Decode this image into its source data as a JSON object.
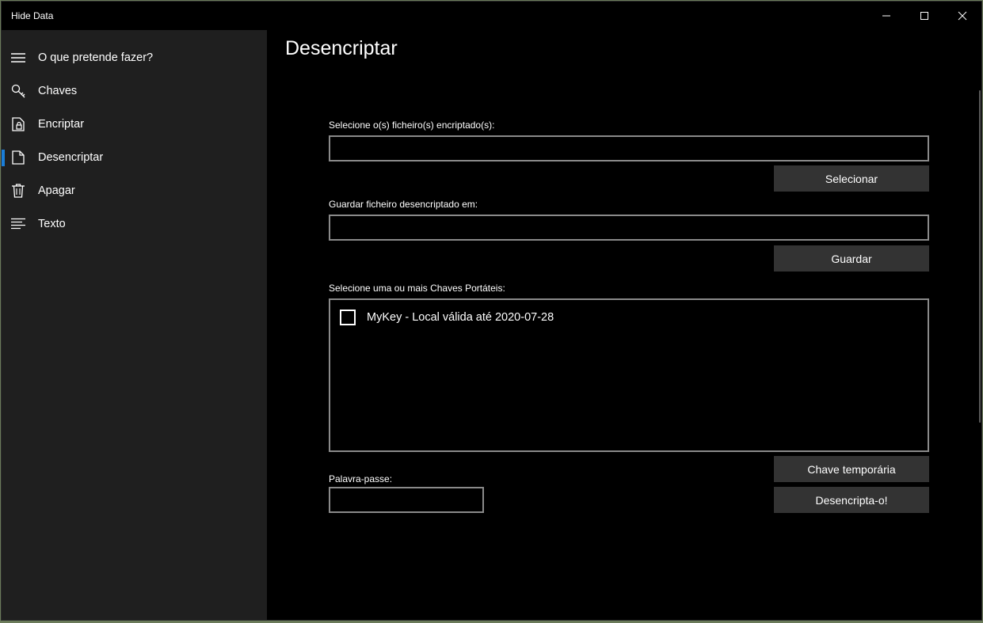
{
  "window": {
    "title": "Hide Data"
  },
  "sidebar": {
    "items": [
      {
        "label": "O que pretende fazer?",
        "icon": "hamburger-icon"
      },
      {
        "label": "Chaves",
        "icon": "key-icon"
      },
      {
        "label": "Encriptar",
        "icon": "lock-document-icon"
      },
      {
        "label": "Desencriptar",
        "icon": "document-icon",
        "selected": true
      },
      {
        "label": "Apagar",
        "icon": "trash-icon"
      },
      {
        "label": "Texto",
        "icon": "text-lines-icon"
      }
    ]
  },
  "main": {
    "title": "Desencriptar",
    "select_files_label": "Selecione o(s) ficheiro(s) encriptado(s):",
    "select_files_value": "",
    "select_button": "Selecionar",
    "save_to_label": "Guardar ficheiro desencriptado em:",
    "save_to_value": "",
    "save_button": "Guardar",
    "keys_label": "Selecione uma ou mais Chaves Portáteis:",
    "keys": [
      {
        "label": "MyKey - Local válida até 2020-07-28",
        "checked": false
      }
    ],
    "password_label": "Palavra-passe:",
    "password_value": "",
    "temp_key_button": "Chave temporária",
    "decrypt_button": "Desencripta-o!"
  },
  "colors": {
    "accent": "#1a7ed8",
    "sidebar_bg": "#1f1f1f",
    "content_bg": "#000000",
    "button_bg": "#333333",
    "input_border": "#8a8a8a"
  }
}
